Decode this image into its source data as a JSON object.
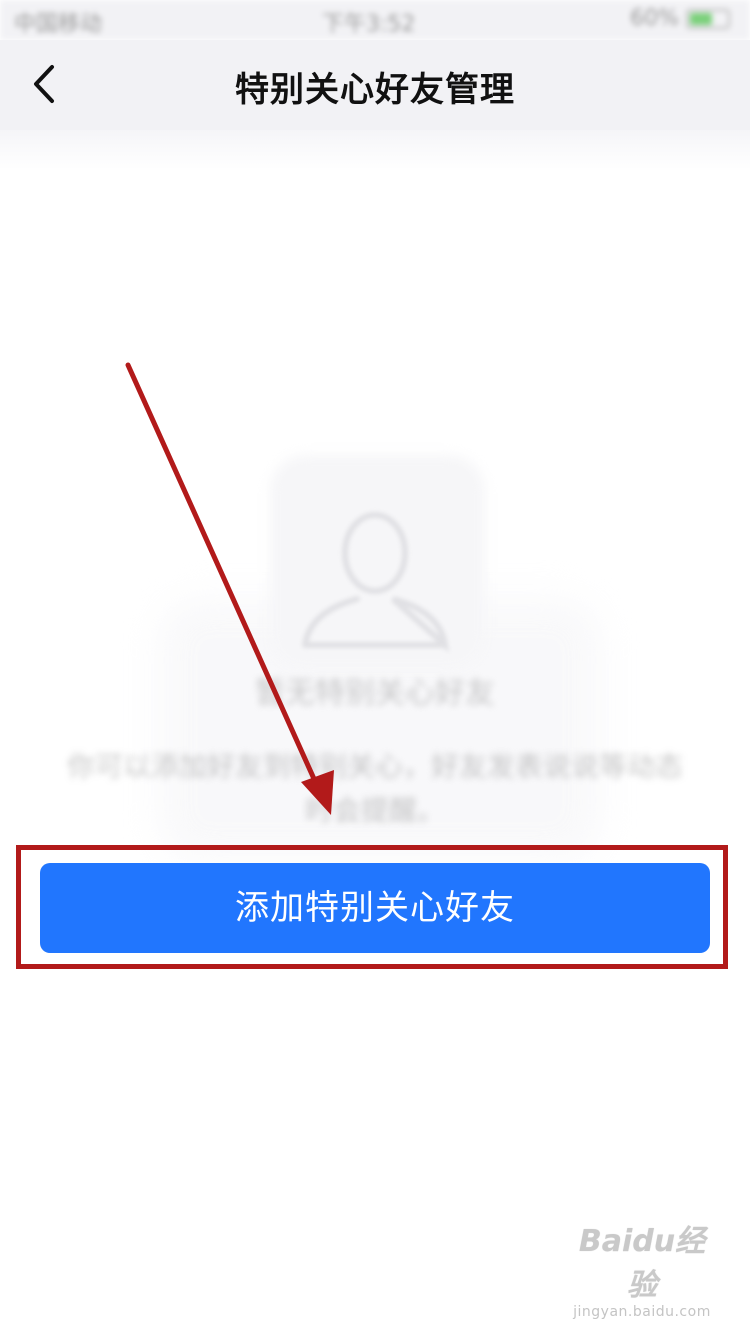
{
  "status_bar": {
    "carrier": "中国移动",
    "time": "下午3:52",
    "battery": "60%"
  },
  "nav": {
    "title": "特别关心好友管理",
    "back_icon": "chevron-left-icon"
  },
  "empty_state": {
    "icon": "person-silhouette-icon",
    "title": "暂无特别关心好友",
    "description": "你可以添加好友到特别关心，好友发表说说等动态时会提醒。"
  },
  "primary_button": {
    "label": "添加特别关心好友",
    "color": "#2176fe"
  },
  "annotation": {
    "color": "#b21a1a"
  },
  "watermark": {
    "logo": "Baidu经验",
    "url": "jingyan.baidu.com"
  }
}
